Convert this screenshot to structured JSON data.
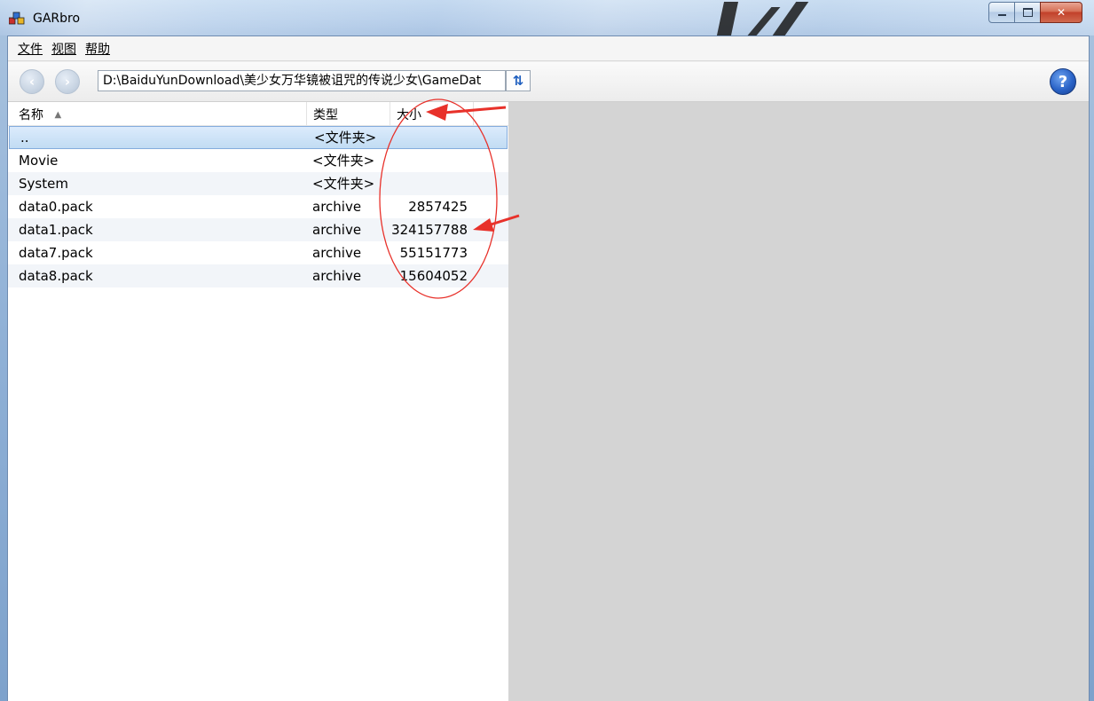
{
  "window": {
    "title": "GARbro",
    "controls": [
      "minimize",
      "maximize",
      "close"
    ]
  },
  "menu": {
    "items": [
      {
        "label": "文件"
      },
      {
        "label": "视图"
      },
      {
        "label": "帮助"
      }
    ]
  },
  "toolbar": {
    "back_icon": "back-arrow-icon",
    "forward_icon": "forward-arrow-icon",
    "path": "D:\\BaiduYunDownload\\美少女万华镜被诅咒的传说少女\\GameDat",
    "refresh_icon": "refresh-icon",
    "help_icon": "help-icon"
  },
  "columns": {
    "name": "名称",
    "type": "类型",
    "size": "大小",
    "sort_indicator": "▲"
  },
  "files": [
    {
      "name": "..",
      "type": "<文件夹>",
      "size": ""
    },
    {
      "name": "Movie",
      "type": "<文件夹>",
      "size": ""
    },
    {
      "name": "System",
      "type": "<文件夹>",
      "size": ""
    },
    {
      "name": "data0.pack",
      "type": "archive",
      "size": "2857425"
    },
    {
      "name": "data1.pack",
      "type": "archive",
      "size": "324157788"
    },
    {
      "name": "data7.pack",
      "type": "archive",
      "size": "55151773"
    },
    {
      "name": "data8.pack",
      "type": "archive",
      "size": "15604052"
    }
  ],
  "selected_index": 0,
  "colors": {
    "annotation": "#e8312a",
    "selection": "#c1dcf3",
    "preview_bg": "#d4d4d4"
  }
}
